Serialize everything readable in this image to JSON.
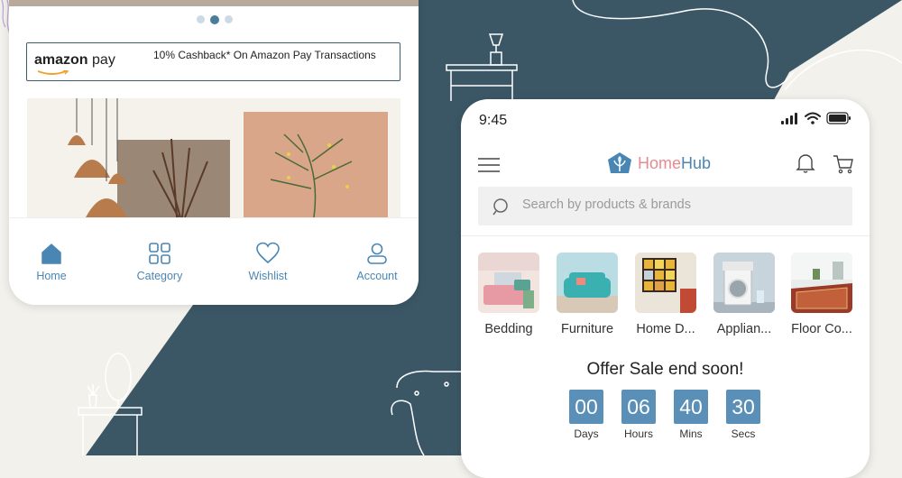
{
  "left_phone": {
    "promo": {
      "logo_main": "amazon",
      "logo_suffix": "pay",
      "text": "10% Cashback* On Amazon Pay Transactions"
    },
    "nav": [
      {
        "label": "Home",
        "icon": "home-icon",
        "active": true
      },
      {
        "label": "Category",
        "icon": "grid-icon"
      },
      {
        "label": "Wishlist",
        "icon": "heart-icon"
      },
      {
        "label": "Account",
        "icon": "user-icon"
      }
    ]
  },
  "right_phone": {
    "time": "9:45",
    "brand": {
      "part1": "Home",
      "part2": "Hub"
    },
    "search": {
      "placeholder": "Search by products & brands"
    },
    "categories": [
      {
        "label": "Bedding"
      },
      {
        "label": "Furniture"
      },
      {
        "label": "Home D..."
      },
      {
        "label": "Applian..."
      },
      {
        "label": "Floor Co..."
      }
    ],
    "offer": {
      "title": "Offer Sale end soon!",
      "timer": [
        {
          "value": "00",
          "unit": "Days"
        },
        {
          "value": "06",
          "unit": "Hours"
        },
        {
          "value": "40",
          "unit": "Mins"
        },
        {
          "value": "30",
          "unit": "Secs"
        }
      ]
    }
  },
  "colors": {
    "accent": "#4a86b4",
    "brand_pink": "#e88a92",
    "bg_dark": "#3b5766",
    "timer_box": "#5a8fb7"
  }
}
